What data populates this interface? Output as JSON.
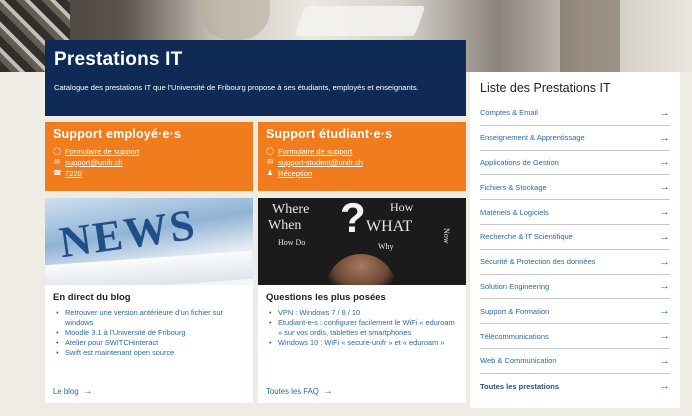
{
  "header": {
    "title": "Prestations IT",
    "description": "Catalogue des prestations IT que l'Université de Fribourg propose à ses étudiants, employés et enseignants."
  },
  "support_employees": {
    "title": "Support employé·e·s",
    "links": [
      {
        "icon": "chat-bubble-icon",
        "text": "Formulaire de support"
      },
      {
        "icon": "envelope-icon",
        "text": "support@unifr.ch"
      },
      {
        "icon": "phone-icon",
        "text": "7220"
      }
    ]
  },
  "support_students": {
    "title": "Support étudiant·e·s",
    "links": [
      {
        "icon": "chat-bubble-icon",
        "text": "Formulaire de support"
      },
      {
        "icon": "envelope-icon",
        "text": "support-student@unifr.ch"
      },
      {
        "icon": "person-icon",
        "text": "Réception"
      }
    ]
  },
  "blog": {
    "image_text": "NEWS",
    "title": "En direct du blog",
    "items": [
      "Retrouver une version antérieure d'un fichier sur windows",
      "Moodle 3.1 à l'Université de Fribourg",
      "Atelier pour SWITCHinteract",
      "Swift est maintenant open source"
    ],
    "link": "Le blog"
  },
  "faq": {
    "image_words": [
      "Where",
      "When",
      "How",
      "WHAT",
      "Why",
      "How Do",
      "Why",
      "Now"
    ],
    "title": "Questions les plus posées",
    "items": [
      "VPN : Windows 7 / 8 / 10",
      "Etudiant-e-s : configurer facilement le WiFi « eduroam » sur vos ordis, tablettes et smartphones",
      "Windows 10 : WiFi « secure-unifr » et « eduroam »"
    ],
    "link": "Toutes les FAQ"
  },
  "sidebar": {
    "title": "Liste des Prestations IT",
    "items": [
      "Comptes & Email",
      "Enseignement & Apprentissage",
      "Applications de Gestion",
      "Fichiers & Stockage",
      "Matériels & Logiciels",
      "Recherche & IT Scientifique",
      "Sécurité & Protection des données",
      "Solution Engineering",
      "Support & Formation",
      "Télécommunications",
      "Web & Communication",
      "Toutes les prestations"
    ]
  },
  "colors": {
    "navy": "#0f2b55",
    "orange": "#f07c1e",
    "link": "#2b6aa8"
  }
}
